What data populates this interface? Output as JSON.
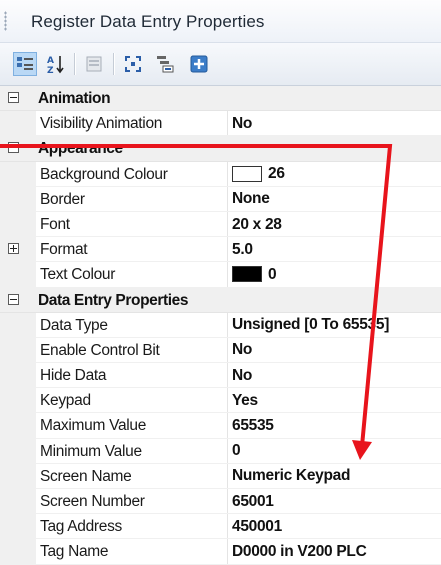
{
  "window": {
    "title": "Register Data Entry Properties"
  },
  "toolbar": {
    "buttons": [
      {
        "name": "categorized-button",
        "icon": "categorized-icon",
        "active": true
      },
      {
        "name": "alphabetical-button",
        "icon": "sort-az-icon",
        "active": false
      },
      {
        "name": "property-pages-button",
        "icon": "property-pages-icon",
        "active": false
      },
      {
        "name": "expand-button",
        "icon": "expand-icon",
        "active": false
      },
      {
        "name": "settings-button",
        "icon": "settings-icon",
        "active": false
      },
      {
        "name": "add-button",
        "icon": "plus-icon",
        "active": false
      }
    ]
  },
  "grid": {
    "animation": {
      "label": "Animation",
      "rows": [
        {
          "name": "Visibility Animation",
          "value": "No"
        }
      ]
    },
    "appearance": {
      "label": "Appearance",
      "rows": [
        {
          "name": "Background Colour",
          "value": "26",
          "swatch": "#ffffff"
        },
        {
          "name": "Border",
          "value": "None"
        },
        {
          "name": "Font",
          "value": "20 x 28"
        },
        {
          "name": "Format",
          "value": "5.0"
        },
        {
          "name": "Text Colour",
          "value": "0",
          "swatch": "#000000"
        }
      ]
    },
    "data_entry": {
      "label": "Data Entry Properties",
      "rows": [
        {
          "name": "Data Type",
          "value": "Unsigned [0 To 65535]"
        },
        {
          "name": "Enable Control Bit",
          "value": "No"
        },
        {
          "name": "Hide Data",
          "value": "No"
        },
        {
          "name": "Keypad",
          "value": "Yes"
        },
        {
          "name": "Maximum Value",
          "value": "65535"
        },
        {
          "name": "Minimum Value",
          "value": "0"
        },
        {
          "name": "Screen Name",
          "value": "Numeric Keypad"
        },
        {
          "name": "Screen Number",
          "value": "65001"
        },
        {
          "name": "Tag Address",
          "value": "450001"
        },
        {
          "name": "Tag Name",
          "value": "D0000 in V200 PLC"
        }
      ]
    }
  },
  "colors": {
    "annotation_arrow": "#e8141c",
    "category_bg": "#f0f0f0",
    "selected_tool": "#b9d8f5"
  }
}
